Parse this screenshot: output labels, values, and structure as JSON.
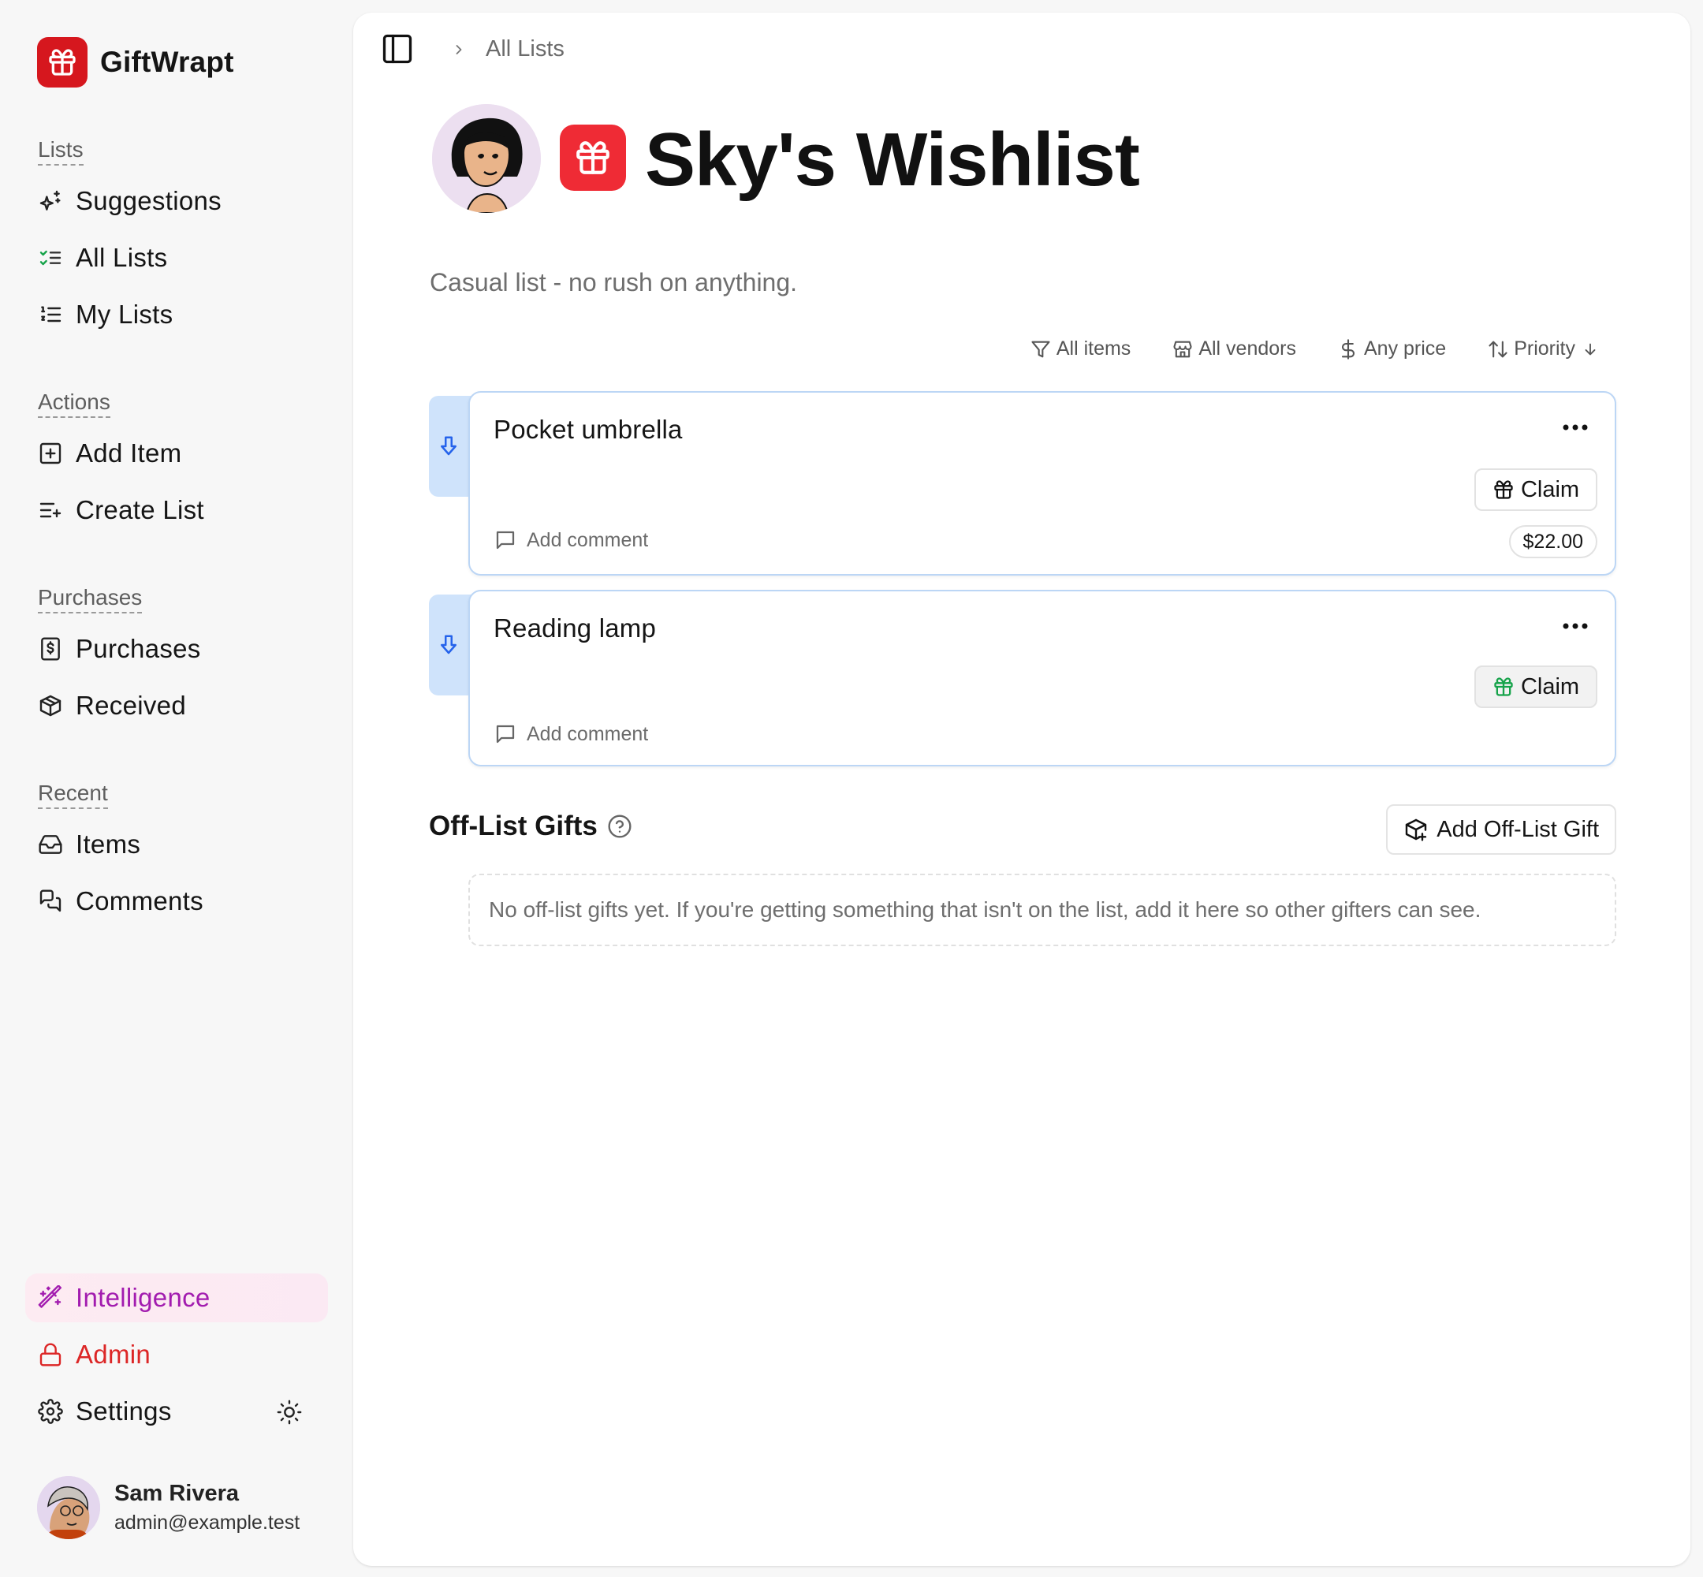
{
  "app": {
    "name": "GiftWrapt"
  },
  "sidebar": {
    "sections": [
      {
        "label": "Lists",
        "items": [
          {
            "label": "Suggestions",
            "icon": "sparkles-icon"
          },
          {
            "label": "All Lists",
            "icon": "list-checks-icon"
          },
          {
            "label": "My Lists",
            "icon": "list-ordered-icon"
          }
        ]
      },
      {
        "label": "Actions",
        "items": [
          {
            "label": "Add Item",
            "icon": "plus-square-icon"
          },
          {
            "label": "Create List",
            "icon": "list-plus-icon"
          }
        ]
      },
      {
        "label": "Purchases",
        "items": [
          {
            "label": "Purchases",
            "icon": "receipt-dollar-icon"
          },
          {
            "label": "Received",
            "icon": "package-icon"
          }
        ]
      },
      {
        "label": "Recent",
        "items": [
          {
            "label": "Items",
            "icon": "inbox-icon"
          },
          {
            "label": "Comments",
            "icon": "messages-icon"
          }
        ]
      }
    ],
    "bottom": {
      "intelligence": "Intelligence",
      "admin": "Admin",
      "settings": "Settings"
    },
    "user": {
      "name": "Sam Rivera",
      "email": "admin@example.test"
    }
  },
  "breadcrumb": {
    "current": "All Lists"
  },
  "list": {
    "title": "Sky's Wishlist",
    "description": "Casual list - no rush on anything."
  },
  "filters": {
    "items": "All items",
    "vendors": "All vendors",
    "price": "Any price",
    "sort": "Priority"
  },
  "items": [
    {
      "name": "Pocket umbrella",
      "claim_label": "Claim",
      "price": "$22.00",
      "comment_placeholder": "Add comment"
    },
    {
      "name": "Reading lamp",
      "claim_label": "Claim",
      "comment_placeholder": "Add comment"
    }
  ],
  "offlist": {
    "title": "Off-List Gifts",
    "button": "Add Off-List Gift",
    "empty": "No off-list gifts yet. If you're getting something that isn't on the list, add it here so other gifters can see."
  },
  "colors": {
    "brand": "#d6171e",
    "accent_blue": "#2563eb",
    "intelligence": "#a21caf",
    "admin": "#dc2626",
    "claim_green": "#16a34a"
  }
}
